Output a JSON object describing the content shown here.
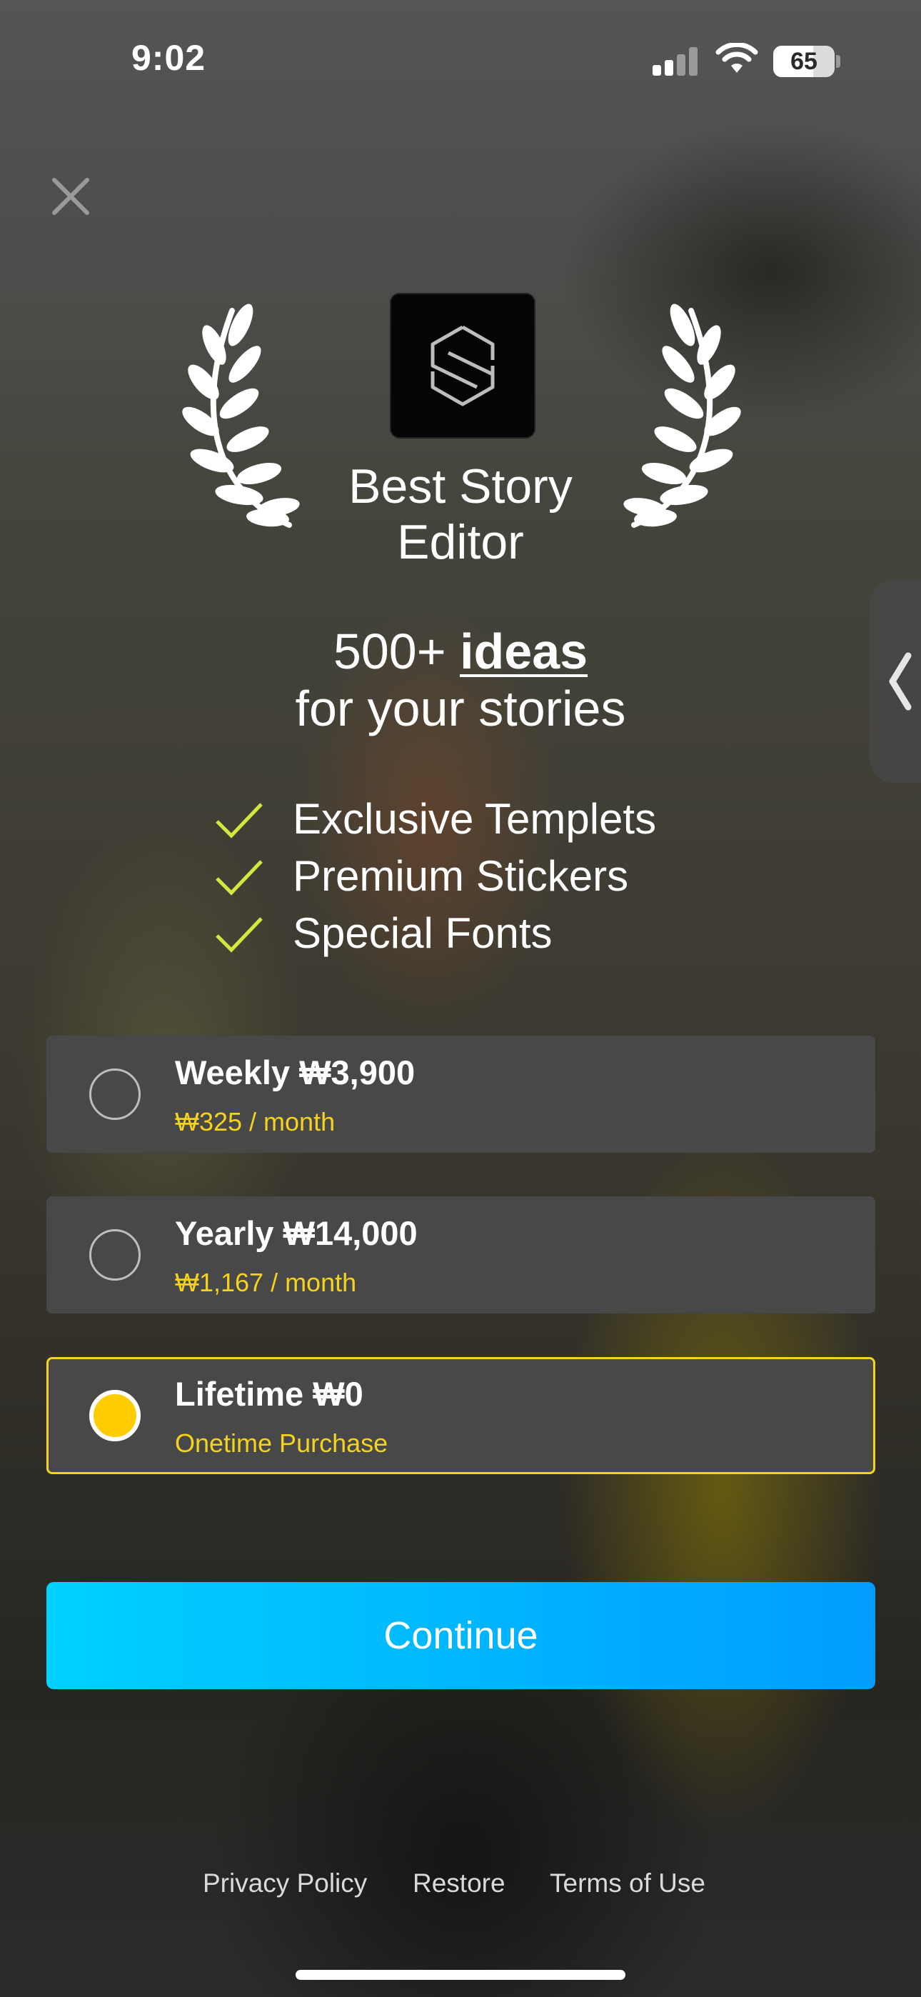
{
  "status_bar": {
    "time": "9:02",
    "battery_level": "65",
    "battery_percent": 65
  },
  "icons": {
    "close": "close-icon",
    "side_tab": "chevron-left-icon",
    "check": "check-icon",
    "laurel": "laurel-icon"
  },
  "hero": {
    "award_title": "Best Story Editor",
    "headline_prefix": "500+ ",
    "headline_bold": "ideas",
    "headline_suffix": "for your stories"
  },
  "features": [
    "Exclusive Templets",
    "Premium Stickers",
    "Special Fonts"
  ],
  "plans": [
    {
      "title": "Weekly ₩3,900",
      "subtitle": "₩325 / month",
      "selected": false
    },
    {
      "title": "Yearly ₩14,000",
      "subtitle": "₩1,167 / month",
      "selected": false
    },
    {
      "title": "Lifetime ₩0",
      "subtitle": "Onetime Purchase",
      "selected": true
    }
  ],
  "cta": {
    "label": "Continue"
  },
  "footer": {
    "privacy": "Privacy Policy",
    "restore": "Restore",
    "terms": "Terms of Use"
  },
  "colors": {
    "accent_yellow": "#f4d21e",
    "radio_selected": "#ffcc00",
    "button_start": "#00d1ff",
    "button_end": "#009cff",
    "card_bg": "#484848"
  }
}
